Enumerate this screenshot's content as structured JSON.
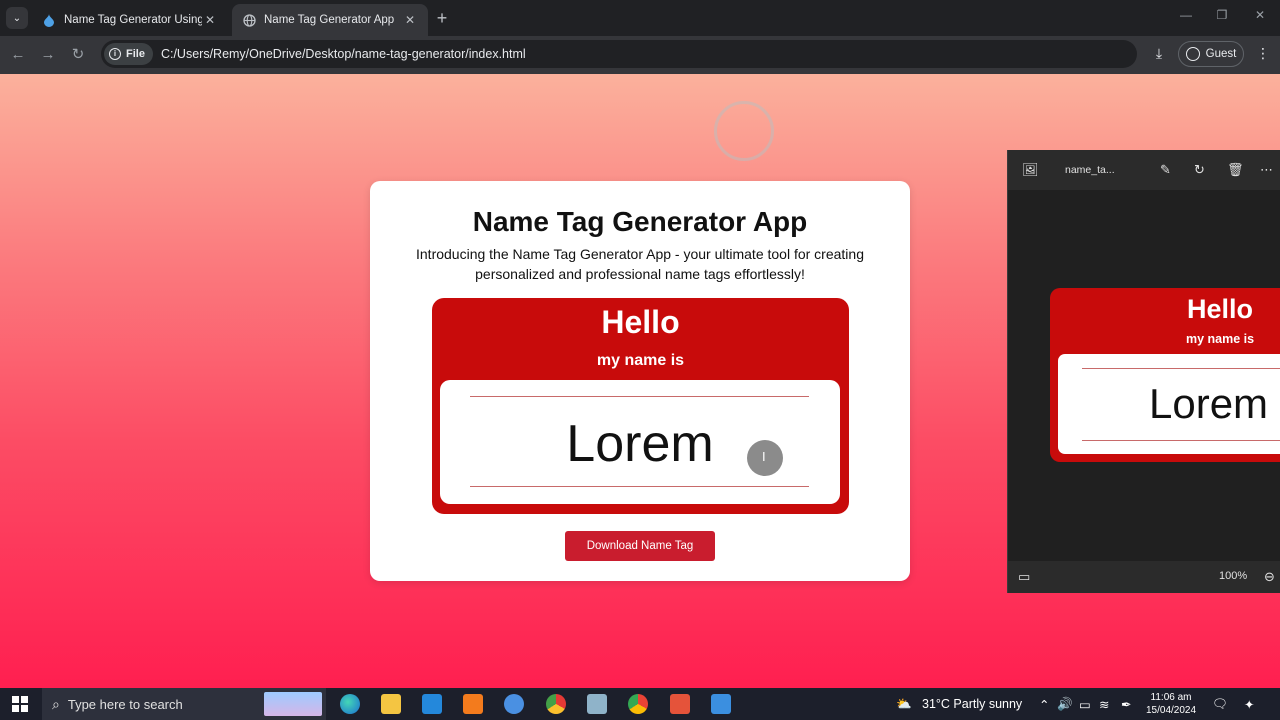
{
  "browser": {
    "tabs": [
      {
        "title": "Name Tag Generator Using HTML",
        "active": false
      },
      {
        "title": "Name Tag Generator App",
        "active": true
      }
    ],
    "security_chip": "File",
    "url": "C:/Users/Remy/OneDrive/Desktop/name-tag-generator/index.html",
    "profile_label": "Guest"
  },
  "page": {
    "title": "Name Tag Generator App",
    "intro": "Introducing the Name Tag Generator App - your ultimate tool for creating personalized and professional name tags effortlessly!",
    "tag": {
      "hello": "Hello",
      "my_name_is": "my name is",
      "name": "Lorem",
      "color": "#c80b0b"
    },
    "download_button": "Download Name Tag",
    "button_color": "#c91d2e"
  },
  "viewer": {
    "filename": "name_ta...",
    "zoom": "100%",
    "preview": {
      "hello": "Hello",
      "my_name_is": "my name is",
      "name": "Lorem"
    }
  },
  "taskbar": {
    "search_placeholder": "Type here to search",
    "weather": "31°C  Partly sunny",
    "time": "11:06 am",
    "date": "15/04/2024"
  }
}
